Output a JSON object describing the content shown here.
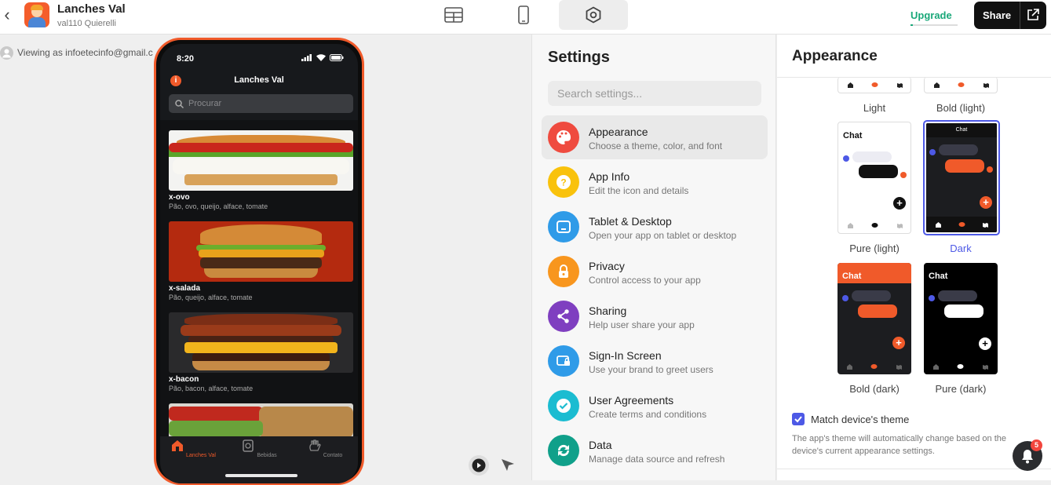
{
  "app": {
    "name": "Lanches Val",
    "owner": "val110 Quierelli"
  },
  "header": {
    "upgrade_label": "Upgrade",
    "share_label": "Share"
  },
  "viewing": {
    "text": "Viewing as infoetecinfo@gmail.c"
  },
  "phone": {
    "time": "8:20",
    "title": "Lanches Val",
    "search_placeholder": "Procurar",
    "items": [
      {
        "name": "x-ovo",
        "desc": "Pão, ovo, queijo, alface, tomate"
      },
      {
        "name": "x-salada",
        "desc": "Pão, queijo, alface, tomate"
      },
      {
        "name": "x-bacon",
        "desc": "Pão, bacon, alface, tomate"
      }
    ],
    "tabs": [
      "Lanches Val",
      "Bebidas",
      "Contato"
    ]
  },
  "settings": {
    "title": "Settings",
    "search_placeholder": "Search settings...",
    "items": [
      {
        "label": "Appearance",
        "desc": "Choose a theme, color, and font",
        "color": "#ef4b3f",
        "icon": "palette-icon"
      },
      {
        "label": "App Info",
        "desc": "Edit the icon and details",
        "color": "#f9c20c",
        "icon": "question-icon"
      },
      {
        "label": "Tablet & Desktop",
        "desc": "Open your app on tablet or desktop",
        "color": "#2f9be8",
        "icon": "tablet-icon"
      },
      {
        "label": "Privacy",
        "desc": "Control access to your app",
        "color": "#f8961e",
        "icon": "lock-icon"
      },
      {
        "label": "Sharing",
        "desc": "Help user share your app",
        "color": "#7f3fc0",
        "icon": "share-icon"
      },
      {
        "label": "Sign-In Screen",
        "desc": "Use your brand to greet users",
        "color": "#2f9be8",
        "icon": "signin-icon"
      },
      {
        "label": "User Agreements",
        "desc": "Create terms and conditions",
        "color": "#1bbcd1",
        "icon": "check-icon"
      },
      {
        "label": "Data",
        "desc": "Manage data source and refresh",
        "color": "#10a08a",
        "icon": "refresh-icon"
      }
    ]
  },
  "appearance": {
    "title": "Appearance",
    "chat_label": "Chat",
    "themes": [
      "Light",
      "Bold (light)",
      "Pure (light)",
      "Dark",
      "Bold (dark)",
      "Pure (dark)"
    ],
    "selected": "Dark",
    "match_label": "Match device's theme",
    "match_checked": true,
    "match_desc": "The app's theme will automatically change based on the device's current appearance settings."
  },
  "notifications": {
    "count": "5"
  },
  "colors": {
    "accent": "#f05a2a",
    "selected": "#4d59e6",
    "upgrade": "#1aa879"
  }
}
